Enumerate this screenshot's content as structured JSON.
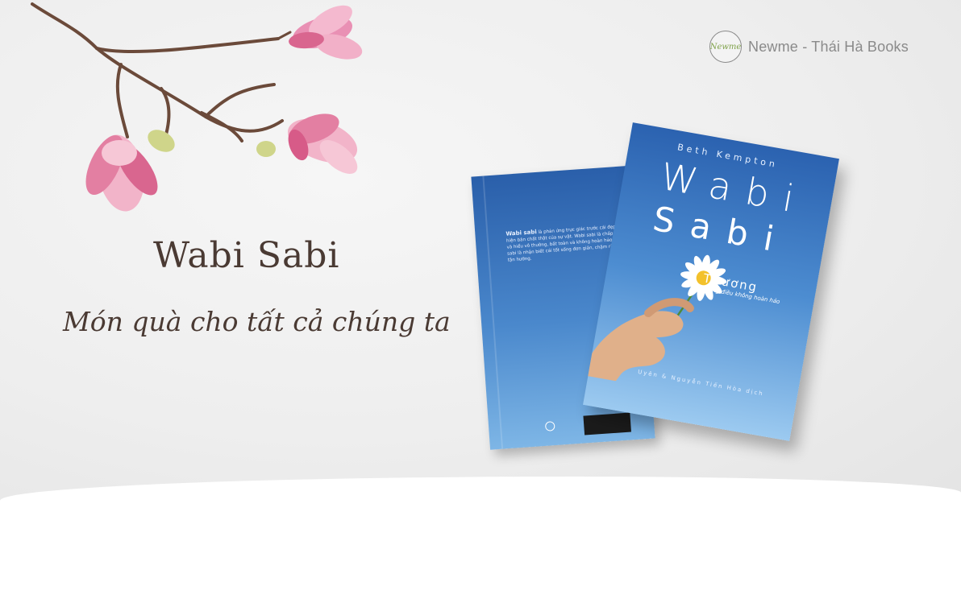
{
  "brand": {
    "logo_text": "Newme",
    "name": "Newme - Thái Hà Books"
  },
  "headline": "Wabi Sabi",
  "tagline": "Món quà cho tất cả chúng ta",
  "book_front": {
    "author": "Beth Kempton",
    "title_line1": "Wabi",
    "title_line2": "Sabi",
    "subtitle": "Thương",
    "subtitle2": "những điều không hoàn hảo",
    "translator": "Uyên & Nguyễn Tiến Hòa dịch"
  },
  "book_back": {
    "blurb_lead": "Wabi sabi",
    "blurb": "là phản ứng trực giác trước cái đẹp thể hiện bản chất thật của sự vật. Wabi sabi là chấp nhận và hiểu vô thường, bất toàn và không hoàn hảo. Wabi sabi là nhận biết cái tốt sống đơn giản, chậm rãi và tận hưởng."
  },
  "colors": {
    "headline_text": "#4a3a33",
    "book_blue": "#2b62b0",
    "brand_text": "#8a8a8a",
    "magnolia": "#e37fa2"
  }
}
